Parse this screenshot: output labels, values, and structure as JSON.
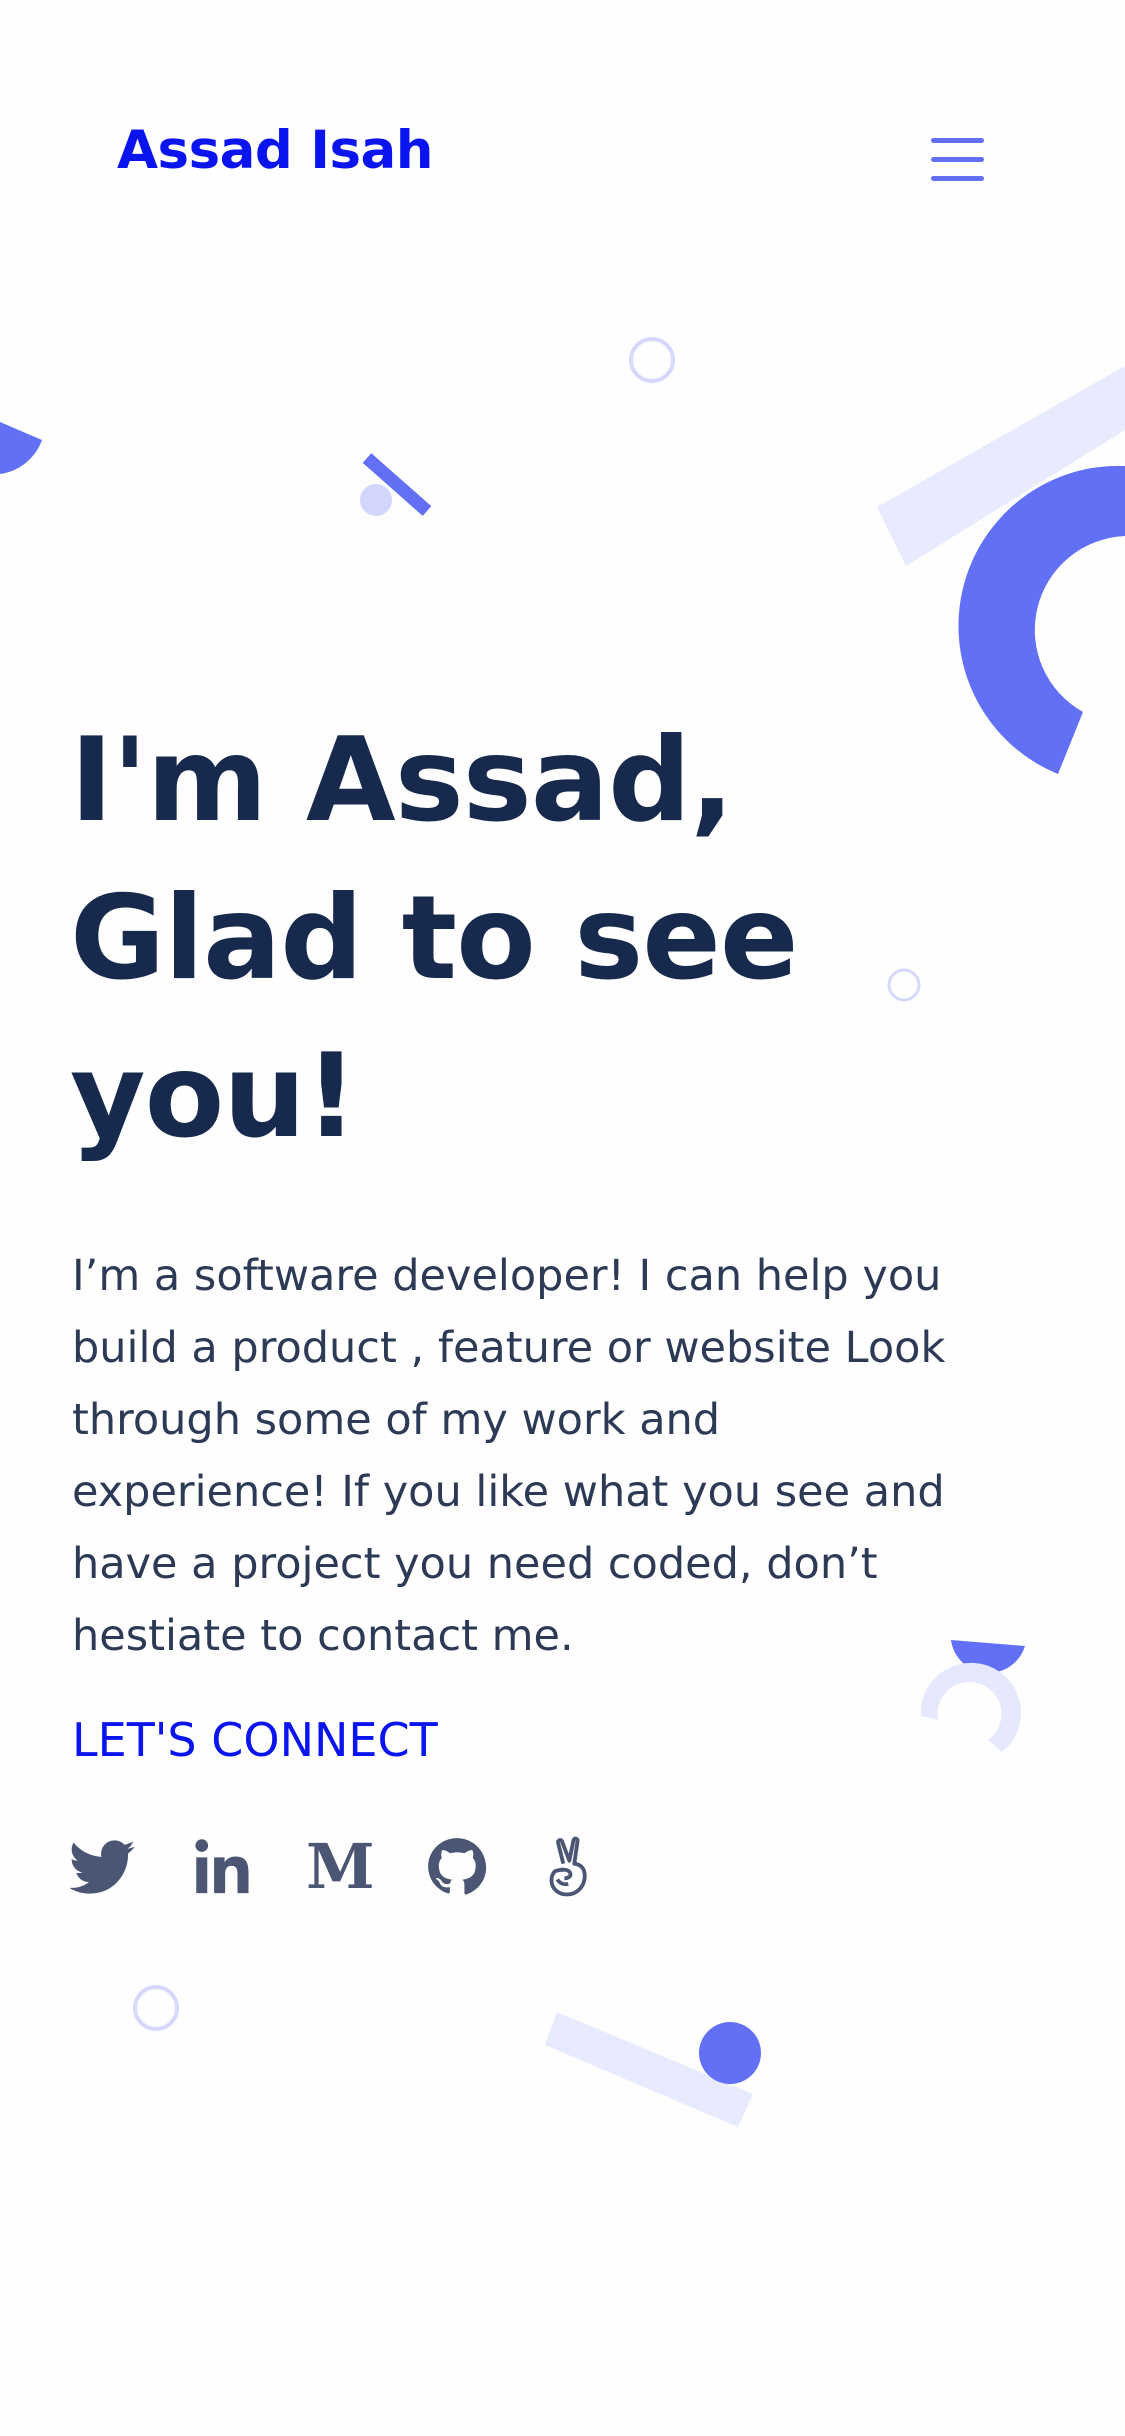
{
  "header": {
    "logo_text": "Assad Isah",
    "menu_icon": "hamburger-menu-icon"
  },
  "hero": {
    "title_lines": [
      "I'm Assad,",
      "Glad to see",
      "you!"
    ],
    "intro_lines": [
      "I’m a software developer! I can help you",
      "build a product , feature or website Look",
      "through some of my work and",
      "experience! If you like what you see and",
      "have a project you need coded, don’t",
      "hestiate to contact me."
    ],
    "cta_label": "LET'S CONNECT"
  },
  "socials": [
    {
      "name": "twitter",
      "icon": "twitter-icon"
    },
    {
      "name": "linkedin",
      "icon": "linkedin-icon",
      "glyph": "in"
    },
    {
      "name": "medium",
      "icon": "medium-icon",
      "glyph": "M"
    },
    {
      "name": "github",
      "icon": "github-icon"
    },
    {
      "name": "angellist",
      "icon": "angellist-icon"
    }
  ],
  "colors": {
    "brand": "#0a14ee",
    "accent": "#6270f6",
    "accent_light": "#e6e8fd",
    "heading": "#172a4d",
    "body": "#2d3a56",
    "icon": "#4a5673"
  }
}
